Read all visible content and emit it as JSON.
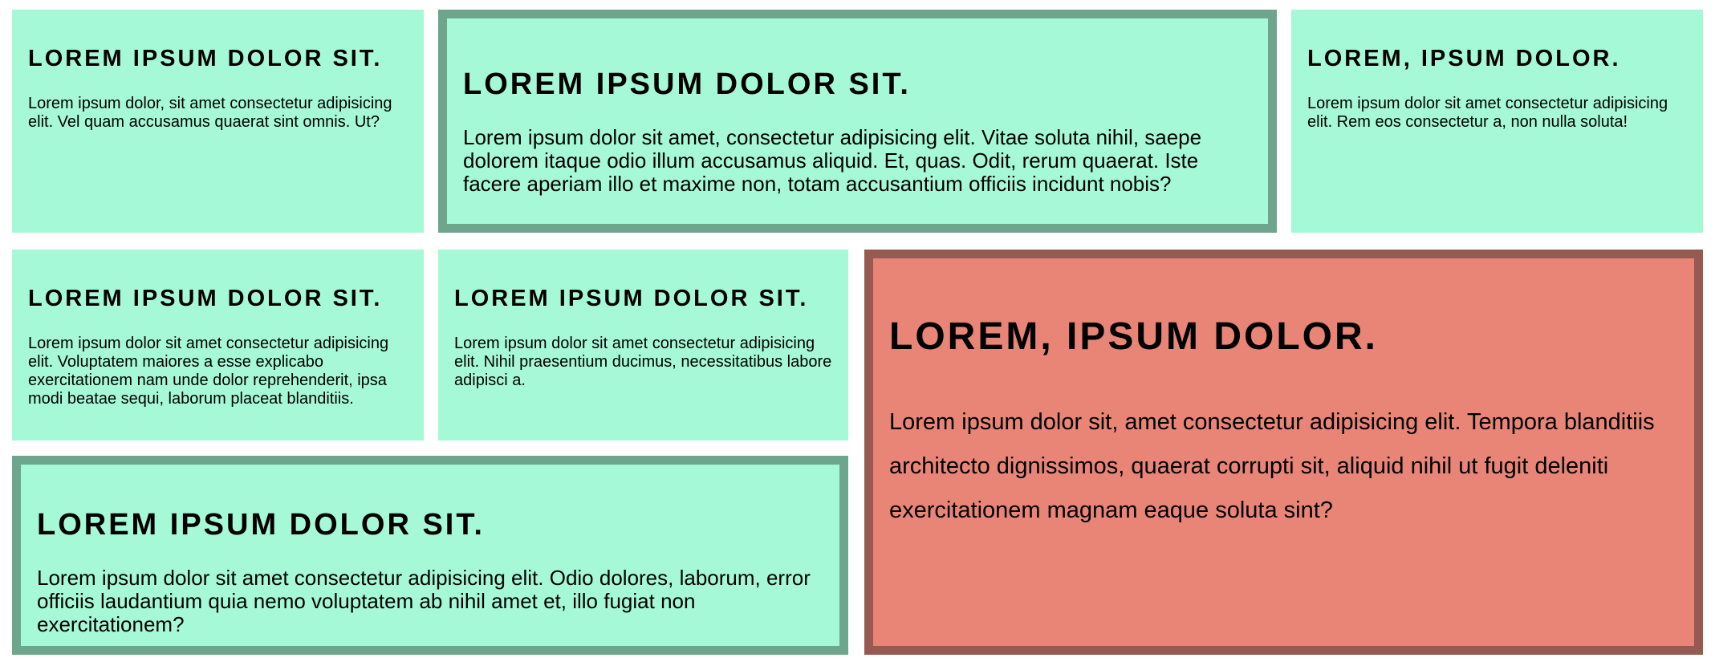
{
  "cards": [
    {
      "title": "LOREM IPSUM DOLOR SIT.",
      "body": "Lorem ipsum dolor, sit amet consectetur adipisicing elit. Vel quam accusamus quaerat sint omnis. Ut?"
    },
    {
      "title": "LOREM IPSUM DOLOR SIT.",
      "body": "Lorem ipsum dolor sit amet, consectetur adipisicing elit. Vitae soluta nihil, saepe dolorem itaque odio illum accusamus aliquid. Et, quas. Odit, rerum quaerat. Iste facere aperiam illo et maxime non, totam accusantium officiis incidunt nobis?"
    },
    {
      "title": "LOREM, IPSUM DOLOR.",
      "body": "Lorem ipsum dolor sit amet consectetur adipisicing elit. Rem eos consectetur a, non nulla soluta!"
    },
    {
      "title": "LOREM IPSUM DOLOR SIT.",
      "body": "Lorem ipsum dolor sit amet consectetur adipisicing elit. Voluptatem maiores a esse explicabo exercitationem nam unde dolor reprehenderit, ipsa modi beatae sequi, laborum placeat blanditiis."
    },
    {
      "title": "LOREM IPSUM DOLOR SIT.",
      "body": "Lorem ipsum dolor sit amet consectetur adipisicing elit. Nihil praesentium ducimus, necessitatibus labore adipisci a."
    },
    {
      "title": "LOREM, IPSUM DOLOR.",
      "body": "Lorem ipsum dolor sit, amet consectetur adipisicing elit. Tempora blanditiis architecto dignissimos, quaerat corrupti sit, aliquid nihil ut fugit deleniti exercitationem magnam eaque soluta sint?"
    },
    {
      "title": "LOREM IPSUM DOLOR SIT.",
      "body": "Lorem ipsum dolor sit amet consectetur adipisicing elit. Odio dolores, laborum, error officiis laudantium quia nemo voluptatem ab nihil amet et, illo fugiat non exercitationem?"
    }
  ],
  "colors": {
    "card_background": "#a6f9d6",
    "featured_border": "#6ea58d",
    "highlight_background": "#e88577",
    "highlight_border": "#955a51",
    "text": "#000000"
  }
}
